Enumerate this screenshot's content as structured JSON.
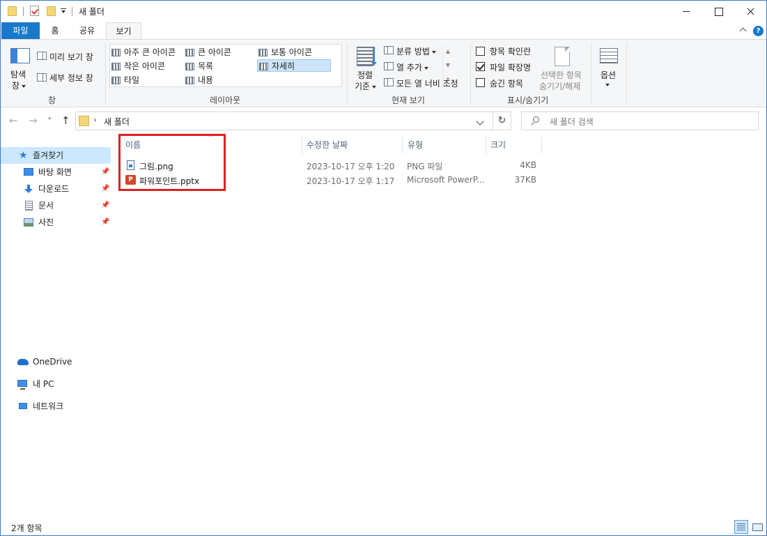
{
  "window": {
    "title": "새 폴더"
  },
  "tabs": {
    "file": "파일",
    "home": "홈",
    "share": "공유",
    "view": "보기"
  },
  "ribbon": {
    "pane": {
      "nav_pane_line1": "탐색",
      "nav_pane_line2": "창",
      "preview_pane": "미리 보기 창",
      "details_pane": "세부 정보 창",
      "group_label": "창"
    },
    "layout": {
      "items": [
        "아주 큰 아이콘",
        "큰 아이콘",
        "보통 아이콘",
        "작은 아이콘",
        "목록",
        "자세히",
        "타일",
        "내용"
      ],
      "selected": "자세히",
      "group_label": "레이아웃"
    },
    "current_view": {
      "sort_line1": "정렬",
      "sort_line2": "기준",
      "group_by": "분류 방법",
      "add_columns": "열 추가",
      "size_all_columns": "모든 열 너비 조정",
      "group_label": "현재 보기"
    },
    "show_hide": {
      "item_checkboxes": "항목 확인란",
      "item_checkboxes_checked": false,
      "file_extensions": "파일 확장명",
      "file_extensions_checked": true,
      "hidden_items": "숨긴 항목",
      "hidden_items_checked": false,
      "hide_selected_line1": "선택한 항목",
      "hide_selected_line2": "숨기기/해제",
      "group_label": "표시/숨기기"
    },
    "options": {
      "label": "옵션"
    }
  },
  "address": {
    "path": "새 폴더",
    "search_placeholder": "새 폴더 검색"
  },
  "navpane": {
    "quick_access": "즐겨찾기",
    "items": [
      {
        "label": "바탕 화면",
        "icon": "desktop-icon"
      },
      {
        "label": "다운로드",
        "icon": "download-icon"
      },
      {
        "label": "문서",
        "icon": "documents-icon"
      },
      {
        "label": "사진",
        "icon": "pictures-icon"
      }
    ],
    "onedrive": "OneDrive",
    "this_pc": "내 PC",
    "network": "네트워크"
  },
  "columns": {
    "name": "이름",
    "modified": "수정한 날짜",
    "type": "유형",
    "size": "크기"
  },
  "files": [
    {
      "name": "그림.png",
      "modified": "2023-10-17 오후 1:20",
      "type": "PNG 파일",
      "size": "4KB",
      "icon": "png-file-icon"
    },
    {
      "name": "파워포인트.pptx",
      "modified": "2023-10-17 오후 1:17",
      "type": "Microsoft PowerP...",
      "size": "37KB",
      "icon": "pptx-file-icon"
    }
  ],
  "status": {
    "item_count": "2개 항목"
  },
  "colors": {
    "accent": "#1979ca",
    "highlight_box": "#e02020",
    "selection": "#cce8ff"
  }
}
